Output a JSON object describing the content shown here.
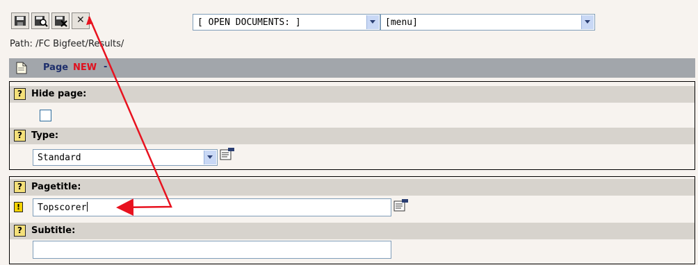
{
  "toolbar": {
    "buttons": [
      {
        "icon": "save-icon"
      },
      {
        "icon": "save-and-preview-icon"
      },
      {
        "icon": "save-and-close-icon"
      },
      {
        "icon": "close-icon",
        "glyph": "✕"
      }
    ],
    "open_documents": {
      "selected": "[ OPEN DOCUMENTS: ]"
    },
    "menu_select": {
      "selected": "[menu]"
    }
  },
  "breadcrumb": {
    "path": "Path: /FC Bigfeet/Results/"
  },
  "header": {
    "page_label": "Page",
    "new_label": "NEW",
    "separator": "-"
  },
  "section1": {
    "hide_page": {
      "label": "Hide page:",
      "help": "?",
      "checked": false
    },
    "type": {
      "label": "Type:",
      "help": "?",
      "selected": "Standard"
    }
  },
  "section2": {
    "pagetitle": {
      "label": "Pagetitle:",
      "help": "?",
      "value": "Topscorer",
      "required_mark": "!"
    },
    "subtitle": {
      "label": "Subtitle:",
      "help": "?",
      "value": ""
    }
  },
  "colors": {
    "accent_header": "#a2a6ab",
    "new_text": "#e0101e",
    "row_bg": "#d7d3cd",
    "annotation_arrow": "#e8121f"
  }
}
